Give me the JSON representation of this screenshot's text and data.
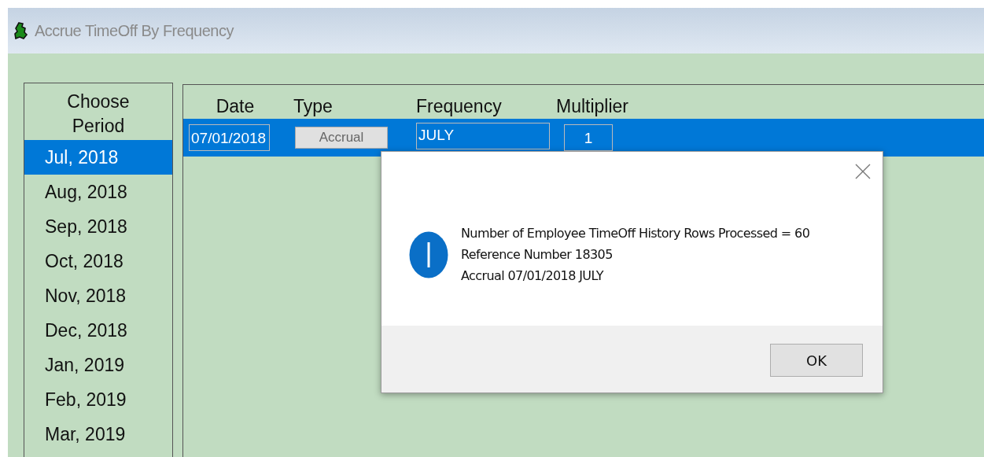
{
  "window": {
    "title": "Accrue TimeOff By Frequency"
  },
  "period_list": {
    "heading": "Choose Period",
    "items": [
      {
        "label": "Jul, 2018",
        "selected": true
      },
      {
        "label": "Aug, 2018",
        "selected": false
      },
      {
        "label": "Sep, 2018",
        "selected": false
      },
      {
        "label": "Oct, 2018",
        "selected": false
      },
      {
        "label": "Nov, 2018",
        "selected": false
      },
      {
        "label": "Dec, 2018",
        "selected": false
      },
      {
        "label": "Jan, 2019",
        "selected": false
      },
      {
        "label": "Feb, 2019",
        "selected": false
      },
      {
        "label": "Mar, 2019",
        "selected": false
      }
    ]
  },
  "grid": {
    "columns": [
      "Date",
      "Type",
      "Frequency",
      "Multiplier"
    ],
    "rows": [
      {
        "date": "07/01/2018",
        "type": "Accrual",
        "frequency": "JULY",
        "multiplier": "1",
        "selected": true
      }
    ]
  },
  "dialog": {
    "lines": [
      "Number of Employee TimeOff History Rows Processed = 60",
      "Reference Number  18305",
      "Accrual 07/01/2018 JULY"
    ],
    "button": "OK"
  }
}
